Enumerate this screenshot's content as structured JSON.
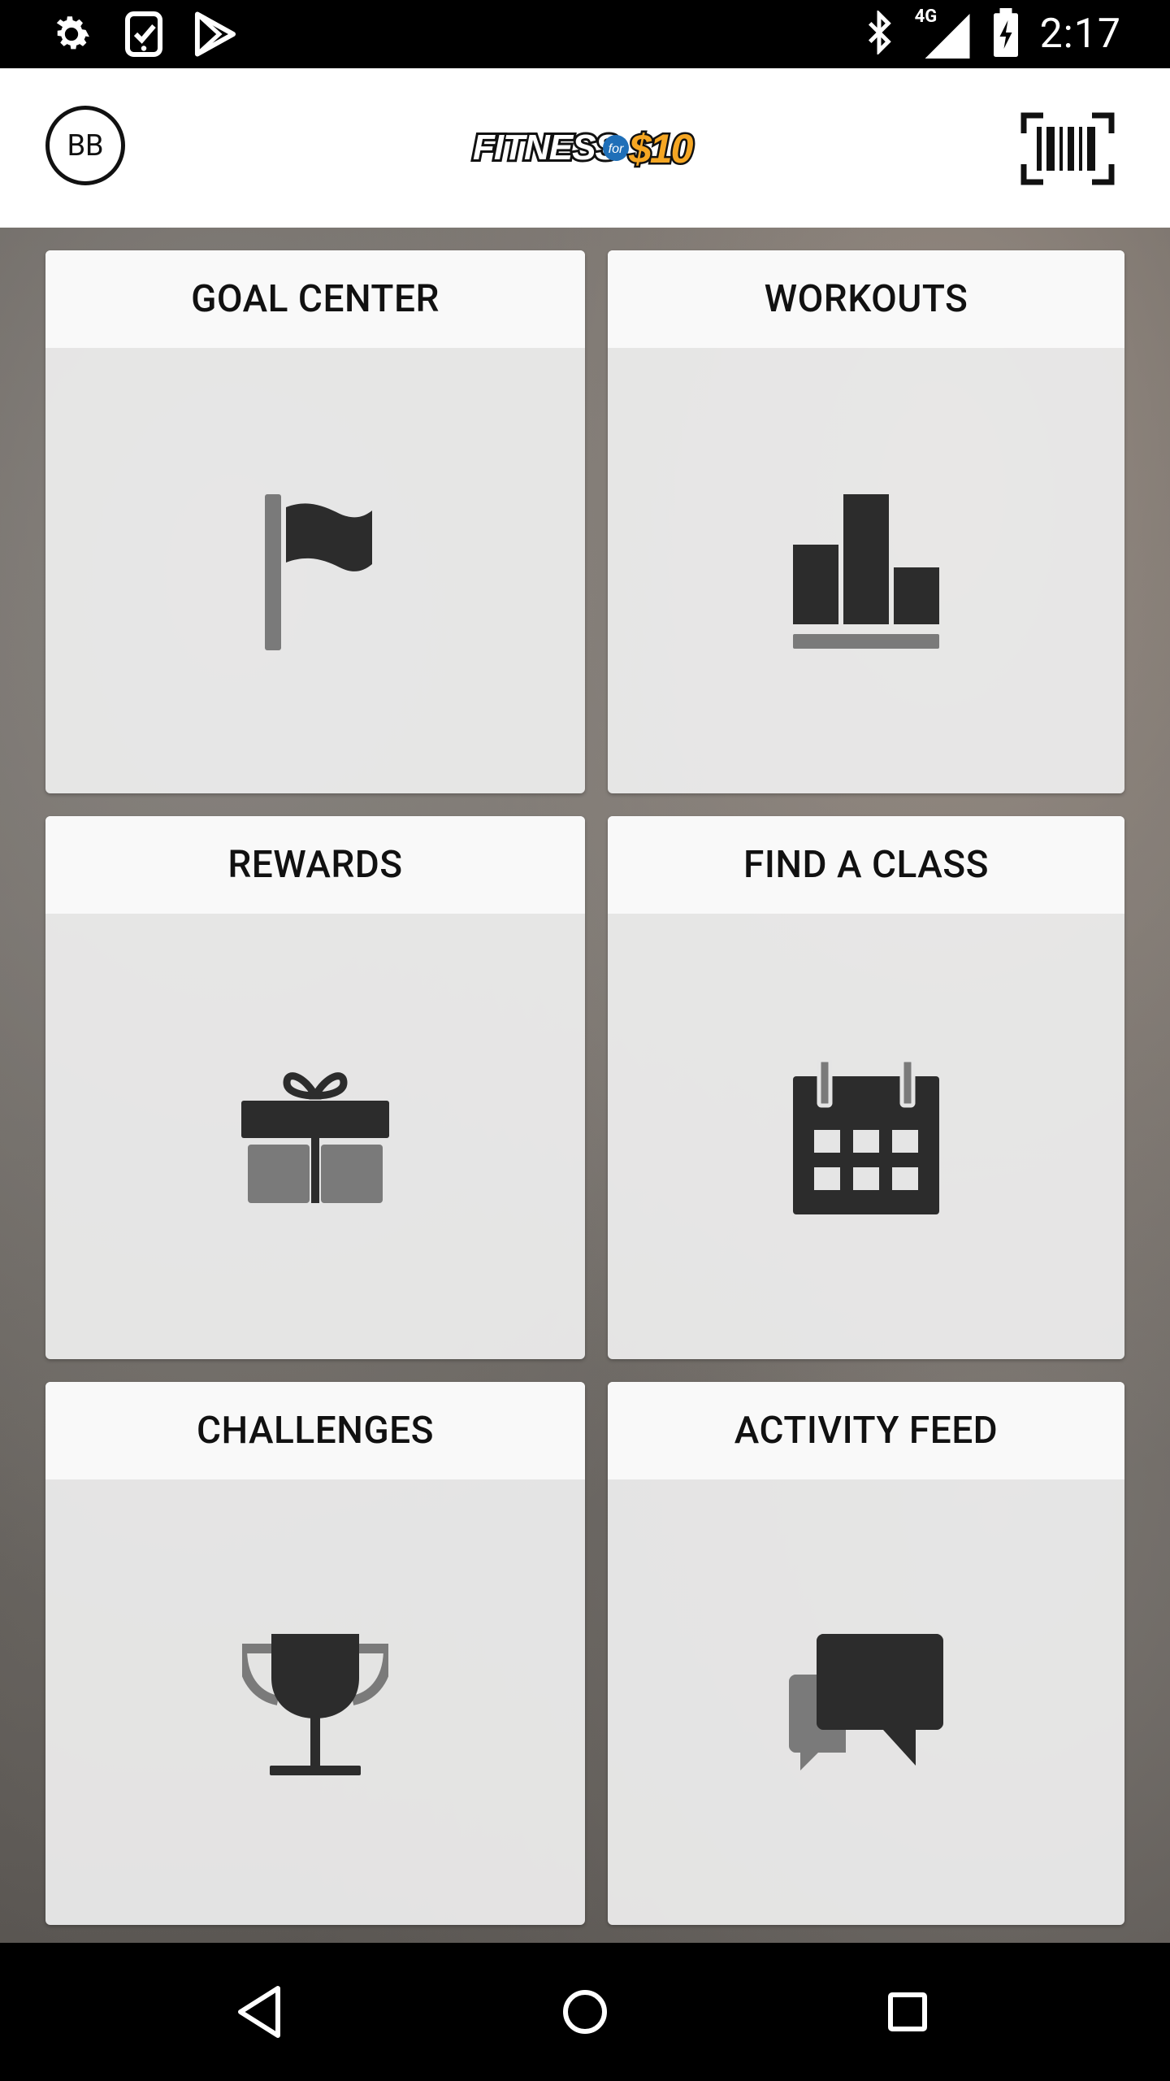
{
  "status_bar": {
    "time": "2:17",
    "network": "4G",
    "icons_left": [
      "settings-icon",
      "clipboard-check-icon",
      "play-store-icon"
    ],
    "icons_right": [
      "bluetooth-icon",
      "signal-icon",
      "battery-charging-icon"
    ]
  },
  "app_bar": {
    "avatar_initials": "BB",
    "logo_text_1": "FITNESS",
    "logo_text_for": "for",
    "logo_text_2": "$10",
    "barcode_icon": "barcode-scanner-icon"
  },
  "tiles": [
    {
      "label": "GOAL CENTER",
      "icon": "flag-icon"
    },
    {
      "label": "WORKOUTS",
      "icon": "bar-chart-icon"
    },
    {
      "label": "REWARDS",
      "icon": "gift-icon"
    },
    {
      "label": "FIND A CLASS",
      "icon": "calendar-icon"
    },
    {
      "label": "CHALLENGES",
      "icon": "trophy-icon"
    },
    {
      "label": "ACTIVITY FEED",
      "icon": "chat-bubbles-icon"
    }
  ],
  "nav_bar": {
    "buttons": [
      "back-icon",
      "home-icon",
      "recents-icon"
    ]
  },
  "colors": {
    "icon_dark": "#2c2c2c",
    "icon_gray": "#7a7a7a",
    "logo_orange": "#f5a623",
    "logo_blue": "#1f6fb8"
  }
}
